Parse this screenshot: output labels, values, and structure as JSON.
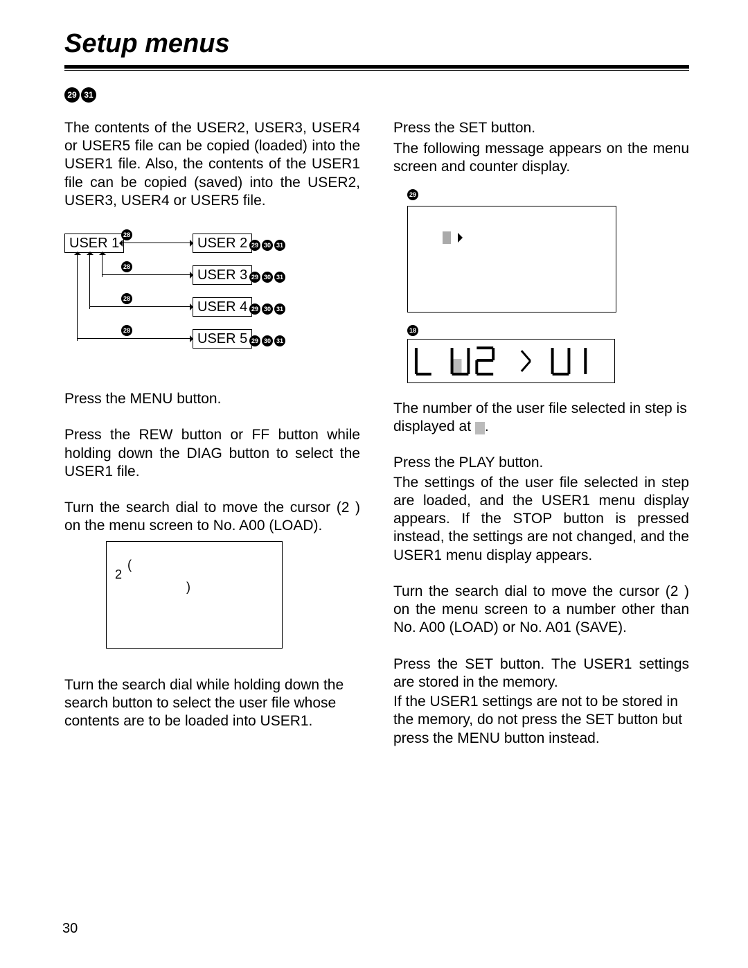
{
  "title": "Setup menus",
  "header_badges": [
    "29",
    "31"
  ],
  "intro": "The contents of the USER2, USER3, USER4 or USER5 file can be copied (loaded) into the USER1 file. Also, the contents of the USER1 file can be copied (saved) into the USER2, USER3, USER4 or USER5 file.",
  "diagram": {
    "user1": "USER 1",
    "users": [
      "USER 2",
      "USER 3",
      "USER 4",
      "USER 5"
    ],
    "top_badge": "28",
    "side_badges": [
      "29",
      "30",
      "31"
    ]
  },
  "steps_left": {
    "s1": "Press the MENU button.",
    "s2": "Press the REW button or FF button while holding down the DIAG button to select the USER1 file.",
    "s3": "Turn the search dial to move the cursor (2 ) on the menu screen to No. A00 (LOAD).",
    "s4": "Turn the search dial while holding down the search button to select the user file whose contents are to be loaded into USER1."
  },
  "menu_screen": {
    "two": "2",
    "paren_open": "(",
    "paren_close": ")"
  },
  "steps_right": {
    "s5a": "Press the SET button.",
    "s5b": "The following message appears on the menu screen and counter display.",
    "panel_label_a": "29",
    "panel_label_b": "18",
    "s6a": "The number of the user file selected in step    is displayed at ",
    "s6b": ".",
    "s7a": "Press the PLAY button.",
    "s7b": "The settings of the user file selected in step    are loaded, and the USER1 menu display appears. If the STOP button is pressed instead, the settings are not changed, and the USER1 menu display appears.",
    "s8": "Turn the search dial to move the cursor (2 ) on the menu screen to a number other than No. A00 (LOAD) or No. A01 (SAVE).",
    "s9a": "Press the SET button. The USER1 settings are stored in the memory.",
    "s9b": "If the USER1 settings are not to be stored in the memory, do not press the SET button but press the MENU button instead."
  },
  "counter_text": "L  U2  >  U1",
  "page_number": "30"
}
